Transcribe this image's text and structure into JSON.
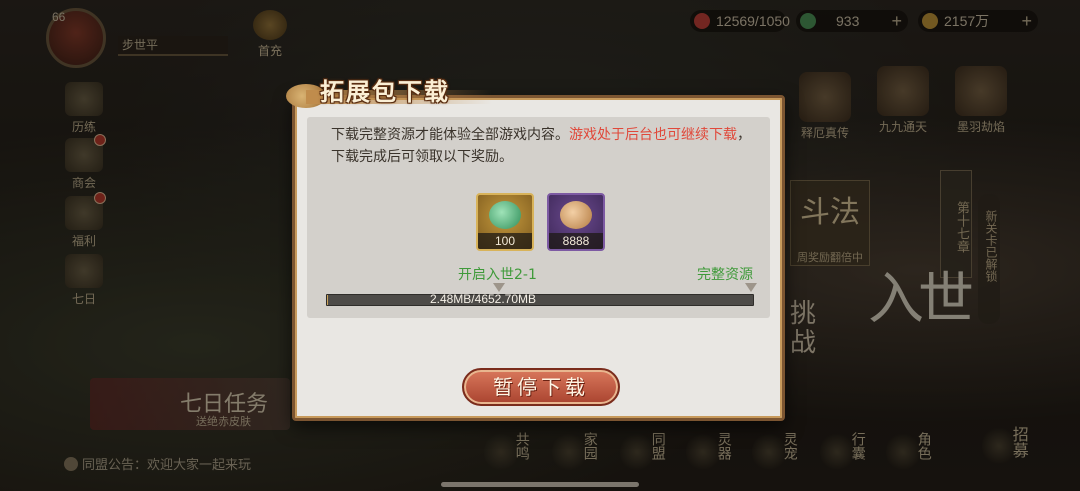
{
  "player": {
    "level": "66",
    "name": "步世平"
  },
  "top_menu": {
    "first_recharge": "首充"
  },
  "resources": [
    {
      "icon": "stamina-icon",
      "value": "12569/1050"
    },
    {
      "icon": "jade-icon",
      "value": "933"
    },
    {
      "icon": "coin-icon",
      "value": "2157万"
    }
  ],
  "left_menu": [
    "历练",
    "商会",
    "福利",
    "七日"
  ],
  "right_menu": [
    "释厄真传",
    "九九通天",
    "墨羽劫焰"
  ],
  "map": {
    "doufa": "斗法",
    "doufa_note": "周奖励翻倍中",
    "chapter": "第十七章",
    "unlock_note": "新关卡已解锁",
    "rushi": "入世",
    "tiaozhan": "挑战"
  },
  "task_banner": {
    "title": "七日任务",
    "subtitle": "送绝赤皮肤"
  },
  "notice": "同盟公告：欢迎大家一起来玩",
  "bottom_menu": [
    "共鸣",
    "家园",
    "同盟",
    "灵器",
    "灵宠",
    "行囊",
    "角色",
    "招募"
  ],
  "dialog": {
    "title": "拓展包下载",
    "desc_normal": "下载完整资源才能体验全部游戏内容。",
    "desc_highlight": "游戏处于后台也可继续下载",
    "desc_tail": "，下载完成后可领取以下奖励。",
    "rewards": [
      {
        "icon": "jade-ring-icon",
        "count": "100"
      },
      {
        "icon": "copper-coin-icon",
        "count": "8888"
      }
    ],
    "marker_start": "开启入世2-1",
    "marker_end": "完整资源",
    "progress_text": "2.48MB/4652.70MB",
    "progress_fraction": 0.0005,
    "pause_button": "暂停下载"
  },
  "colors": {
    "highlight_red": "#e0483a",
    "marker_green": "#3f9a3a",
    "button_red": "#b84e36"
  }
}
